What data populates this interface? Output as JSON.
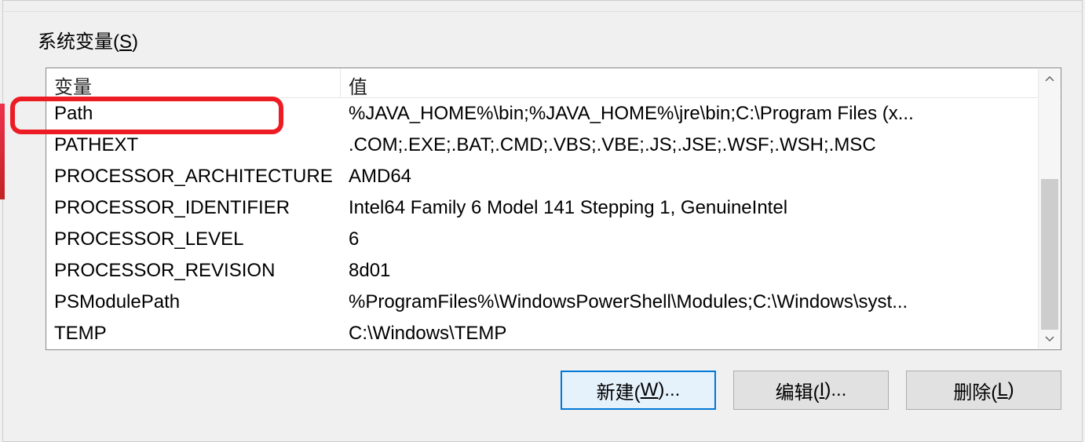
{
  "section": {
    "label_prefix": "系统变量(",
    "label_accel": "S",
    "label_suffix": ")"
  },
  "columns": {
    "name": "变量",
    "value": "值"
  },
  "rows": [
    {
      "name": "Path",
      "value": "%JAVA_HOME%\\bin;%JAVA_HOME%\\jre\\bin;C:\\Program Files (x..."
    },
    {
      "name": "PATHEXT",
      "value": ".COM;.EXE;.BAT;.CMD;.VBS;.VBE;.JS;.JSE;.WSF;.WSH;.MSC"
    },
    {
      "name": "PROCESSOR_ARCHITECTURE",
      "value": "AMD64"
    },
    {
      "name": "PROCESSOR_IDENTIFIER",
      "value": "Intel64 Family 6 Model 141 Stepping 1, GenuineIntel"
    },
    {
      "name": "PROCESSOR_LEVEL",
      "value": "6"
    },
    {
      "name": "PROCESSOR_REVISION",
      "value": "8d01"
    },
    {
      "name": "PSModulePath",
      "value": "%ProgramFiles%\\WindowsPowerShell\\Modules;C:\\Windows\\syst..."
    },
    {
      "name": "TEMP",
      "value": "C:\\Windows\\TEMP"
    }
  ],
  "buttons": {
    "new": {
      "prefix": "新建(",
      "accel": "W",
      "suffix": ")..."
    },
    "edit": {
      "prefix": "编辑(",
      "accel": "I",
      "suffix": ")..."
    },
    "delete": {
      "prefix": "删除(",
      "accel": "L",
      "suffix": ")"
    }
  },
  "highlight_row_name": "Path"
}
